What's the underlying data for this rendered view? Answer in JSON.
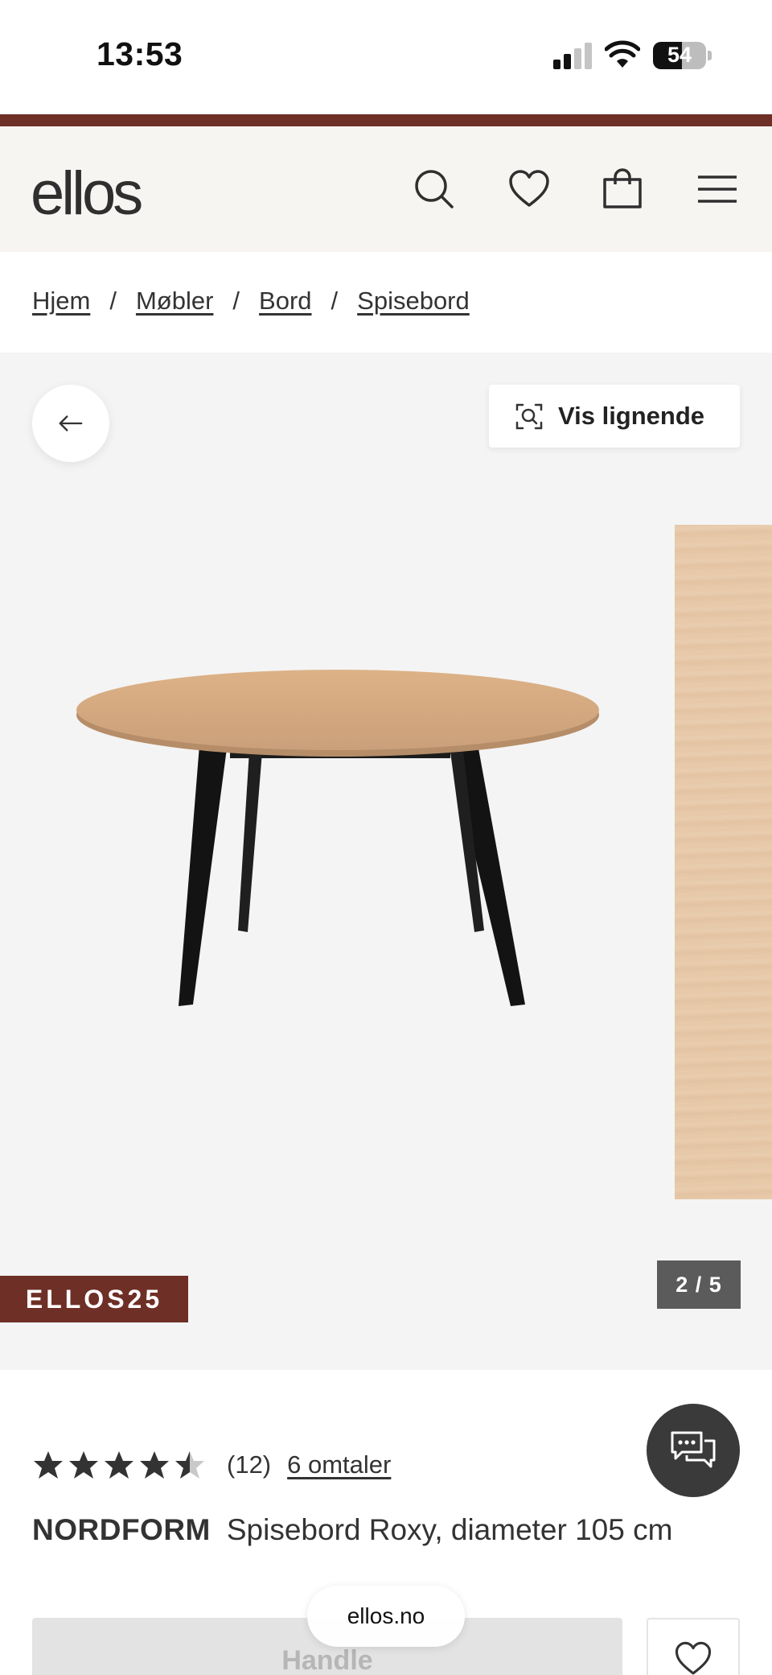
{
  "status_bar": {
    "time": "13:53",
    "battery": "54"
  },
  "header": {
    "logo": "ellos"
  },
  "breadcrumb": [
    "Hjem",
    "Møbler",
    "Bord",
    "Spisebord"
  ],
  "gallery": {
    "similar_label": "Vis lignende",
    "promo_code": "ELLOS25",
    "counter": "2 / 5"
  },
  "product": {
    "rating": 4.5,
    "rating_count": "(12)",
    "reviews_link": "6 omtaler",
    "brand": "NORDFORM",
    "name": "Spisebord Roxy, diameter 105 cm"
  },
  "actions": {
    "buy_label": "Handle"
  },
  "browser": {
    "url": "ellos.no"
  }
}
